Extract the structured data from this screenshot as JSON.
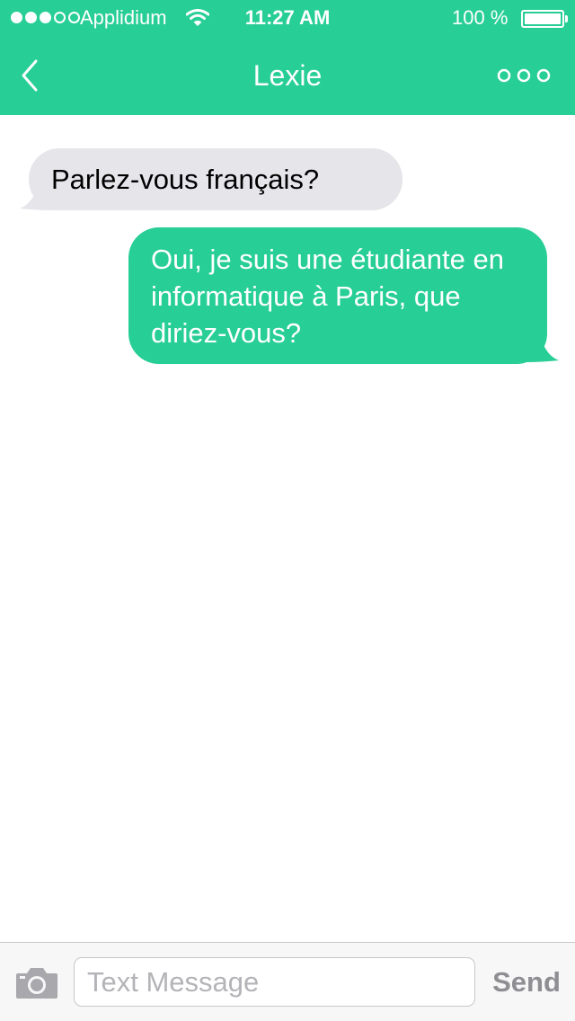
{
  "status_bar": {
    "carrier": "Applidium",
    "time": "11:27 AM",
    "battery": "100 %",
    "signal_icon": "signal-dots-icon",
    "wifi_icon": "wifi-icon",
    "battery_icon": "battery-icon"
  },
  "nav": {
    "title": "Lexie",
    "back_icon": "chevron-left-icon",
    "more_icon": "more-circles-icon"
  },
  "messages": [
    {
      "direction": "incoming",
      "text": "Parlez-vous français?"
    },
    {
      "direction": "outgoing",
      "lines": [
        "Oui, je suis une étudiante en",
        "informatique à Paris, que",
        "diriez-vous?"
      ]
    }
  ],
  "composer": {
    "camera_icon": "camera-icon",
    "placeholder": "Text Message",
    "value": "",
    "send_label": "Send"
  },
  "colors": {
    "accent": "#27ce95",
    "incoming_bubble": "#e5e5ea",
    "send_disabled": "#8e8e93"
  }
}
